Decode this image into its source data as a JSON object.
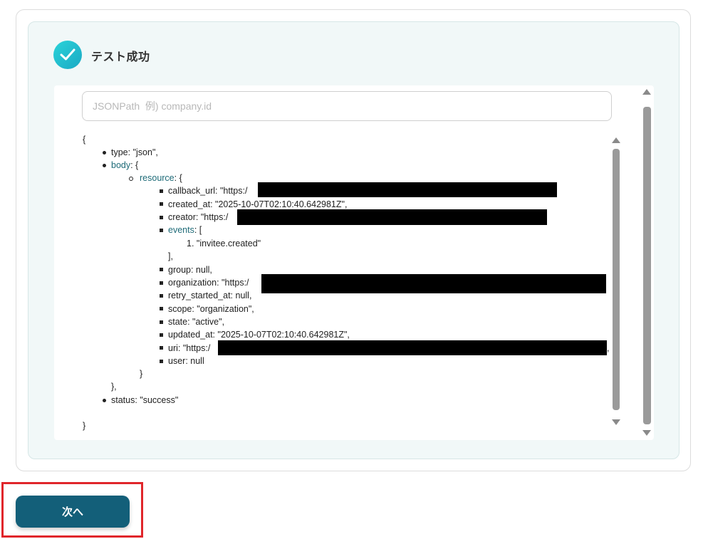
{
  "header": {
    "title": "テスト成功",
    "icon": "check-circle-icon"
  },
  "search": {
    "placeholder": "JSONPath  例) company.id",
    "value": ""
  },
  "json_view": {
    "open_brace": "{",
    "close_brace": "}",
    "type_line": "type: \"json\",",
    "body_key": "body",
    "body_open": ": {",
    "resource_key": "resource",
    "resource_open": ": {",
    "callback_url": "callback_url: \"https:/",
    "created_at": "created_at: \"2025-10-07T02:10:40.642981Z\",",
    "creator": "creator: \"https:/",
    "events_key": "events",
    "events_open": ": [",
    "events_item_num": "1.",
    "events_item": "\"invitee.created\"",
    "events_close": "],",
    "group": "group: null,",
    "organization": "organization: \"https:/",
    "retry_started_at": "retry_started_at: null,",
    "scope": "scope: \"organization\",",
    "state": "state: \"active\",",
    "updated_at": "updated_at: \"2025-10-07T02:10:40.642981Z\",",
    "uri": "uri: \"https:/",
    "uri_trail": ",",
    "user": "user: null",
    "resource_close": "}",
    "body_close": "},",
    "status": "status: \"success\""
  },
  "footer": {
    "next_label": "次へ"
  },
  "colors": {
    "accent": "#135f79",
    "success": "#2bd3d9",
    "highlight": "#e0262b",
    "key_link": "#1e6b78"
  }
}
